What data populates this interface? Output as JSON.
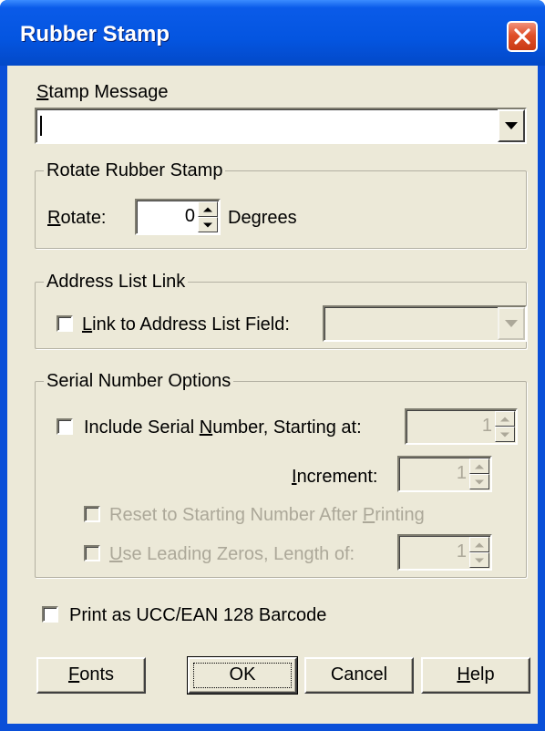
{
  "window": {
    "title": "Rubber Stamp",
    "close_icon": "close-icon"
  },
  "stamp_message": {
    "label_mnemonic": "S",
    "label_rest": "tamp Message",
    "value": ""
  },
  "rotate_group": {
    "legend": "Rotate Rubber Stamp",
    "label_mnemonic": "R",
    "label_rest": "otate:",
    "value": "0",
    "unit": "Degrees"
  },
  "address_group": {
    "legend": "Address List Link",
    "checkbox_mnemonic": "L",
    "checkbox_rest": "ink to Address List Field:",
    "checked": false,
    "field_value": ""
  },
  "serial_group": {
    "legend": "Serial Number Options",
    "include_pre": "Include Serial ",
    "include_mnemonic": "N",
    "include_post": "umber, Starting at:",
    "include_checked": false,
    "starting_value": "1",
    "increment_mnemonic": "I",
    "increment_rest": "ncrement:",
    "increment_value": "1",
    "reset_pre": "Reset to Starting Number After ",
    "reset_mnemonic": "P",
    "reset_post": "rinting",
    "reset_checked": false,
    "zeros_mnemonic": "U",
    "zeros_rest": "se Leading Zeros, Length of:",
    "zeros_checked": false,
    "length_value": "1"
  },
  "ucc": {
    "label": "Print as UCC/EAN 128 Barcode",
    "checked": false
  },
  "buttons": {
    "fonts_mnemonic": "F",
    "fonts_rest": "onts",
    "ok": "OK",
    "cancel": "Cancel",
    "help_mnemonic": "H",
    "help_rest": "elp"
  },
  "colors": {
    "titlebar": "#0455e0",
    "dialog_face": "#ece9d8",
    "disabled_text": "#aca899",
    "close_button": "#e0502a"
  }
}
